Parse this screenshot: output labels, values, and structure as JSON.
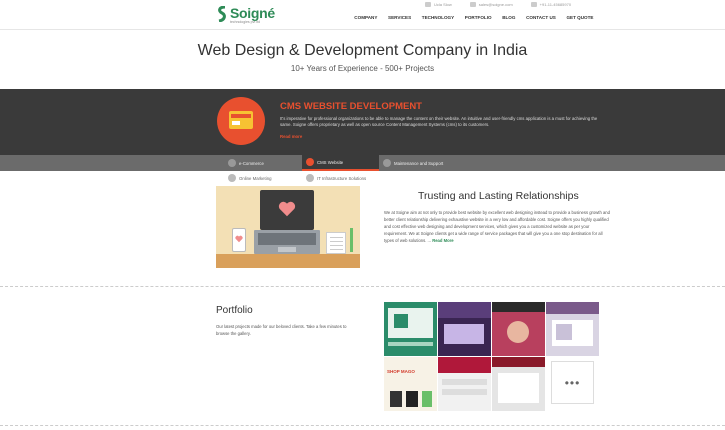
{
  "header": {
    "logo": {
      "brand": "Soigné",
      "tagline": "technologies pvt ltd"
    },
    "contact": {
      "skype": "Ucla Slow",
      "email": "sales@soigne.com",
      "phone": "+91-11-45685970"
    },
    "nav": [
      "COMPANY",
      "SERVICES",
      "TECHNOLOGY",
      "PORTFOLIO",
      "BLOG",
      "CONTACT US",
      "GET QUOTE"
    ]
  },
  "hero": {
    "title": "Web Design & Development Company in India",
    "subtitle": "10+ Years of Experience - 500+ Projects"
  },
  "service_band": {
    "title": "CMS WEBSITE DEVELOPMENT",
    "text": "It's imperative for professional organizations to be able to manage the content on their website. An intuitive and user-friendly cms application is a must for achieving the same. Soigne offers proprietary as well as open source Content Management Systems (cms) to its customers.",
    "more": "Read more",
    "accent": "#e8502f"
  },
  "service_tabs": [
    {
      "label": "e-Commerce"
    },
    {
      "label": "CMS Website"
    },
    {
      "label": "Maintenance and Support"
    }
  ],
  "service_subtabs": [
    {
      "label": "Online Marketing"
    },
    {
      "label": "IT Infrastructure Solutions"
    }
  ],
  "trust": {
    "title": "Trusting and Lasting Relationships",
    "text": "We at Soigne aim at not only to provide best website by excellent web designing instead to provide a business growth and better client relationship delivering exhaustive website in a very low and affordable cost. Soigne offers you highly qualified and cost effective web designing and development services, which gives you a customized website as per your requirement. We at Soigne clients get a wide range of service packages that will give you a one stop destination for all types of web solutions. ...",
    "more": "Read More"
  },
  "portfolio": {
    "title": "Portfolio",
    "text": "Our latest projects made for our beloved clients. Take a few minutes to browse the gallery.",
    "thumbs": [
      {
        "label": "",
        "color": "#2b8c6a"
      },
      {
        "label": "",
        "color": "#5a3e7a"
      },
      {
        "label": "",
        "color": "#b8405e"
      },
      {
        "label": "",
        "color": "#c9c1d8"
      },
      {
        "label": "SHOP MAGO",
        "color": "#f1b63d"
      },
      {
        "label": "",
        "color": "#b0183a"
      },
      {
        "label": "",
        "color": "#e5e5e5"
      }
    ],
    "more_glyph": "•••"
  }
}
